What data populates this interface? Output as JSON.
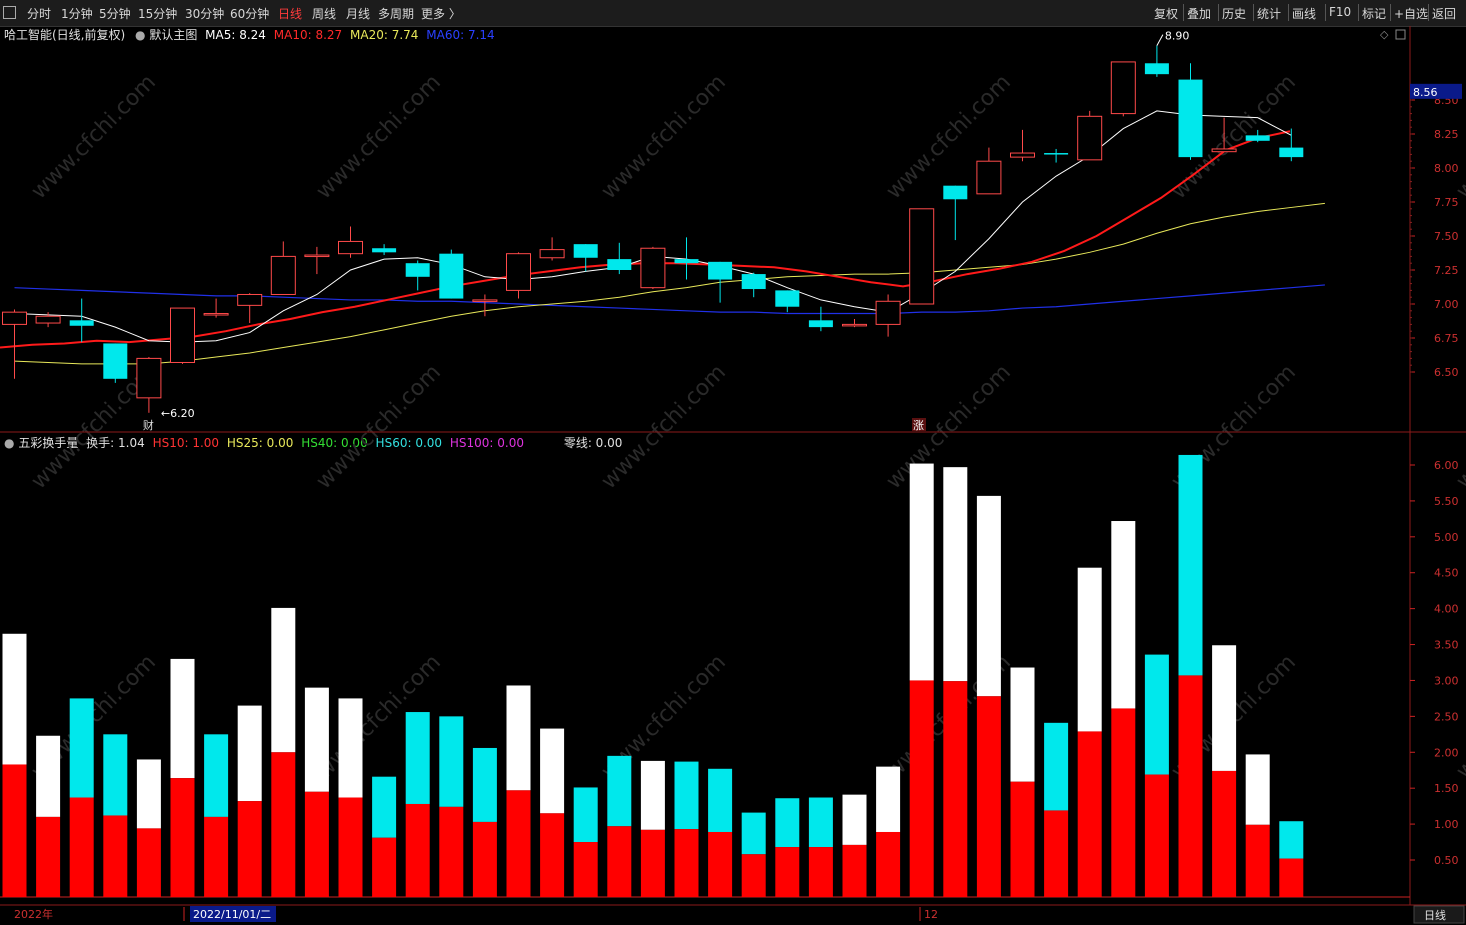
{
  "toolbar": {
    "periods": [
      "分时",
      "1分钟",
      "5分钟",
      "15分钟",
      "30分钟",
      "60分钟",
      "日线",
      "周线",
      "月线",
      "多周期",
      "更多 〉"
    ],
    "active": "日线",
    "right": [
      "复权",
      "叠加",
      "历史",
      "统计",
      "画线",
      "F10",
      "标记",
      "+自选",
      "返回"
    ]
  },
  "main_info": {
    "stock": "哈工智能(日线,前复权)",
    "template": "默认主图",
    "ma5": "MA5: 8.24",
    "ma10": "MA10: 8.27",
    "ma20": "MA20: 7.74",
    "ma60": "MA60: 7.14"
  },
  "sub_info": {
    "name": "五彩换手量",
    "hs": "换手: 1.04",
    "hs10": "HS10: 1.00",
    "hs25": "HS25: 0.00",
    "hs40": "HS40: 0.00",
    "hs60": "HS60: 0.00",
    "hs100": "HS100: 0.00",
    "zero": "零线: 0.00"
  },
  "price_axis": [
    "8.50",
    "8.25",
    "8.00",
    "7.75",
    "7.50",
    "7.25",
    "7.00",
    "6.75",
    "6.50"
  ],
  "current_price": "8.56",
  "vol_axis": [
    "6.00",
    "5.50",
    "5.00",
    "4.50",
    "4.00",
    "3.50",
    "3.00",
    "2.50",
    "2.00",
    "1.50",
    "1.00",
    "0.50"
  ],
  "annotations": {
    "high": "8.90",
    "low": "6.20",
    "cai": "财",
    "zhang": "涨"
  },
  "time_axis": {
    "year": "2022年",
    "cursor": "2022/11/01/二",
    "month12": "12",
    "period_button": "日线"
  },
  "colors": {
    "up": "#ff4a4a",
    "down": "#00e8ec",
    "ma5": "#ffffff",
    "ma10": "#ff1a1a",
    "ma20": "#e8e85a",
    "ma60": "#2030e8"
  },
  "chart_data": {
    "type": "candlestick",
    "candles": [
      {
        "o": 6.85,
        "c": 6.94,
        "h": 6.96,
        "l": 6.45
      },
      {
        "o": 6.86,
        "c": 6.91,
        "h": 6.94,
        "l": 6.83
      },
      {
        "o": 6.88,
        "c": 6.84,
        "h": 7.04,
        "l": 6.72
      },
      {
        "o": 6.71,
        "c": 6.45,
        "h": 6.71,
        "l": 6.42
      },
      {
        "o": 6.31,
        "c": 6.6,
        "h": 6.61,
        "l": 6.2
      },
      {
        "o": 6.57,
        "c": 6.97,
        "h": 6.97,
        "l": 6.56
      },
      {
        "o": 6.92,
        "c": 6.93,
        "h": 7.04,
        "l": 6.9
      },
      {
        "o": 6.99,
        "c": 7.07,
        "h": 7.08,
        "l": 6.86
      },
      {
        "o": 7.07,
        "c": 7.35,
        "h": 7.46,
        "l": 7.07
      },
      {
        "o": 7.35,
        "c": 7.36,
        "h": 7.42,
        "l": 7.22
      },
      {
        "o": 7.37,
        "c": 7.46,
        "h": 7.57,
        "l": 7.34
      },
      {
        "o": 7.41,
        "c": 7.38,
        "h": 7.44,
        "l": 7.36
      },
      {
        "o": 7.3,
        "c": 7.2,
        "h": 7.32,
        "l": 7.1
      },
      {
        "o": 7.37,
        "c": 7.04,
        "h": 7.4,
        "l": 7.04
      },
      {
        "o": 7.02,
        "c": 7.03,
        "h": 7.07,
        "l": 6.91
      },
      {
        "o": 7.1,
        "c": 7.37,
        "h": 7.38,
        "l": 7.04
      },
      {
        "o": 7.34,
        "c": 7.4,
        "h": 7.49,
        "l": 7.32
      },
      {
        "o": 7.44,
        "c": 7.34,
        "h": 7.44,
        "l": 7.24
      },
      {
        "o": 7.33,
        "c": 7.25,
        "h": 7.45,
        "l": 7.22
      },
      {
        "o": 7.12,
        "c": 7.41,
        "h": 7.42,
        "l": 7.11
      },
      {
        "o": 7.33,
        "c": 7.3,
        "h": 7.49,
        "l": 7.18
      },
      {
        "o": 7.31,
        "c": 7.18,
        "h": 7.31,
        "l": 7.01
      },
      {
        "o": 7.22,
        "c": 7.11,
        "h": 7.23,
        "l": 7.05
      },
      {
        "o": 7.1,
        "c": 6.98,
        "h": 7.1,
        "l": 6.94
      },
      {
        "o": 6.88,
        "c": 6.83,
        "h": 6.98,
        "l": 6.8
      },
      {
        "o": 6.84,
        "c": 6.85,
        "h": 6.89,
        "l": 6.83
      },
      {
        "o": 6.85,
        "c": 7.02,
        "h": 7.07,
        "l": 6.76
      },
      {
        "o": 7.0,
        "c": 7.7,
        "h": 7.7,
        "l": 7.0
      },
      {
        "o": 7.87,
        "c": 7.77,
        "h": 7.87,
        "l": 7.47
      },
      {
        "o": 7.81,
        "c": 8.05,
        "h": 8.15,
        "l": 7.81
      },
      {
        "o": 8.08,
        "c": 8.11,
        "h": 8.28,
        "l": 8.05
      },
      {
        "o": 8.11,
        "c": 8.1,
        "h": 8.14,
        "l": 8.04
      },
      {
        "o": 8.06,
        "c": 8.38,
        "h": 8.42,
        "l": 8.06
      },
      {
        "o": 8.4,
        "c": 8.78,
        "h": 8.78,
        "l": 8.38
      },
      {
        "o": 8.77,
        "c": 8.69,
        "h": 8.9,
        "l": 8.67
      },
      {
        "o": 8.65,
        "c": 8.08,
        "h": 8.77,
        "l": 8.06
      },
      {
        "o": 8.12,
        "c": 8.14,
        "h": 8.37,
        "l": 8.12
      },
      {
        "o": 8.24,
        "c": 8.2,
        "h": 8.28,
        "l": 8.19
      },
      {
        "o": 8.15,
        "c": 8.08,
        "h": 8.29,
        "l": 8.05
      }
    ],
    "ma5": [
      6.93,
      6.92,
      6.91,
      6.83,
      6.73,
      6.72,
      6.73,
      6.79,
      6.95,
      7.07,
      7.25,
      7.33,
      7.34,
      7.29,
      7.2,
      7.18,
      7.2,
      7.24,
      7.27,
      7.35,
      7.33,
      7.28,
      7.22,
      7.12,
      7.03,
      6.98,
      6.94,
      7.08,
      7.24,
      7.48,
      7.75,
      7.94,
      8.09,
      8.29,
      8.42,
      8.39,
      8.38,
      8.37,
      8.24
    ],
    "ma10": [
      6.68,
      6.7,
      6.71,
      6.73,
      6.72,
      6.74,
      6.76,
      6.8,
      6.85,
      6.89,
      6.94,
      6.98,
      7.03,
      7.08,
      7.13,
      7.17,
      7.21,
      7.24,
      7.27,
      7.29,
      7.3,
      7.3,
      7.29,
      7.28,
      7.27,
      7.24,
      7.2,
      7.16,
      7.13,
      7.17,
      7.22,
      7.26,
      7.31,
      7.39,
      7.5,
      7.64,
      7.78,
      7.95,
      8.13,
      8.22,
      8.27
    ],
    "ma20": [
      6.58,
      6.57,
      6.56,
      6.56,
      6.56,
      6.58,
      6.61,
      6.64,
      6.68,
      6.72,
      6.76,
      6.81,
      6.86,
      6.91,
      6.95,
      6.98,
      7.0,
      7.02,
      7.05,
      7.09,
      7.12,
      7.16,
      7.18,
      7.2,
      7.21,
      7.22,
      7.22,
      7.23,
      7.25,
      7.27,
      7.29,
      7.33,
      7.38,
      7.44,
      7.52,
      7.59,
      7.64,
      7.68,
      7.71,
      7.74
    ],
    "ma60": [
      7.12,
      7.11,
      7.1,
      7.09,
      7.08,
      7.07,
      7.06,
      7.06,
      7.05,
      7.04,
      7.03,
      7.03,
      7.02,
      7.02,
      7.01,
      7.0,
      6.99,
      6.98,
      6.97,
      6.96,
      6.95,
      6.94,
      6.94,
      6.93,
      6.93,
      6.93,
      6.93,
      6.94,
      6.94,
      6.95,
      6.97,
      6.98,
      7.0,
      7.02,
      7.04,
      7.06,
      7.08,
      7.1,
      7.12,
      7.14
    ],
    "turnover": [
      {
        "t": 3.65,
        "r": 1.83,
        "c": "w"
      },
      {
        "t": 2.23,
        "r": 1.1,
        "c": "w"
      },
      {
        "t": 2.75,
        "r": 1.37,
        "c": "c"
      },
      {
        "t": 2.25,
        "r": 1.12,
        "c": "c"
      },
      {
        "t": 1.9,
        "r": 0.94,
        "c": "w"
      },
      {
        "t": 3.3,
        "r": 1.64,
        "c": "w"
      },
      {
        "t": 2.25,
        "r": 1.1,
        "c": "c"
      },
      {
        "t": 2.65,
        "r": 1.32,
        "c": "w"
      },
      {
        "t": 4.01,
        "r": 2.0,
        "c": "w"
      },
      {
        "t": 2.9,
        "r": 1.45,
        "c": "w"
      },
      {
        "t": 2.75,
        "r": 1.37,
        "c": "w"
      },
      {
        "t": 1.66,
        "r": 0.81,
        "c": "c"
      },
      {
        "t": 2.56,
        "r": 1.28,
        "c": "c"
      },
      {
        "t": 2.5,
        "r": 1.24,
        "c": "c"
      },
      {
        "t": 2.06,
        "r": 1.03,
        "c": "c"
      },
      {
        "t": 2.93,
        "r": 1.47,
        "c": "w"
      },
      {
        "t": 2.33,
        "r": 1.15,
        "c": "w"
      },
      {
        "t": 1.51,
        "r": 0.75,
        "c": "c"
      },
      {
        "t": 1.95,
        "r": 0.97,
        "c": "c"
      },
      {
        "t": 1.88,
        "r": 0.92,
        "c": "w"
      },
      {
        "t": 1.87,
        "r": 0.93,
        "c": "c"
      },
      {
        "t": 1.77,
        "r": 0.89,
        "c": "c"
      },
      {
        "t": 1.16,
        "r": 0.58,
        "c": "c"
      },
      {
        "t": 1.36,
        "r": 0.68,
        "c": "c"
      },
      {
        "t": 1.37,
        "r": 0.68,
        "c": "c"
      },
      {
        "t": 1.41,
        "r": 0.71,
        "c": "w"
      },
      {
        "t": 1.8,
        "r": 0.89,
        "c": "w"
      },
      {
        "t": 6.02,
        "r": 3.0,
        "c": "w"
      },
      {
        "t": 5.97,
        "r": 2.99,
        "c": "w"
      },
      {
        "t": 5.57,
        "r": 2.78,
        "c": "w"
      },
      {
        "t": 3.18,
        "r": 1.59,
        "c": "w"
      },
      {
        "t": 2.41,
        "r": 1.19,
        "c": "c"
      },
      {
        "t": 4.57,
        "r": 2.29,
        "c": "w"
      },
      {
        "t": 5.22,
        "r": 2.61,
        "c": "w"
      },
      {
        "t": 3.36,
        "r": 1.69,
        "c": "c"
      },
      {
        "t": 6.14,
        "r": 3.07,
        "c": "c"
      },
      {
        "t": 3.49,
        "r": 1.74,
        "c": "w"
      },
      {
        "t": 1.97,
        "r": 0.99,
        "c": "w"
      },
      {
        "t": 1.04,
        "r": 0.52,
        "c": "c"
      }
    ]
  }
}
